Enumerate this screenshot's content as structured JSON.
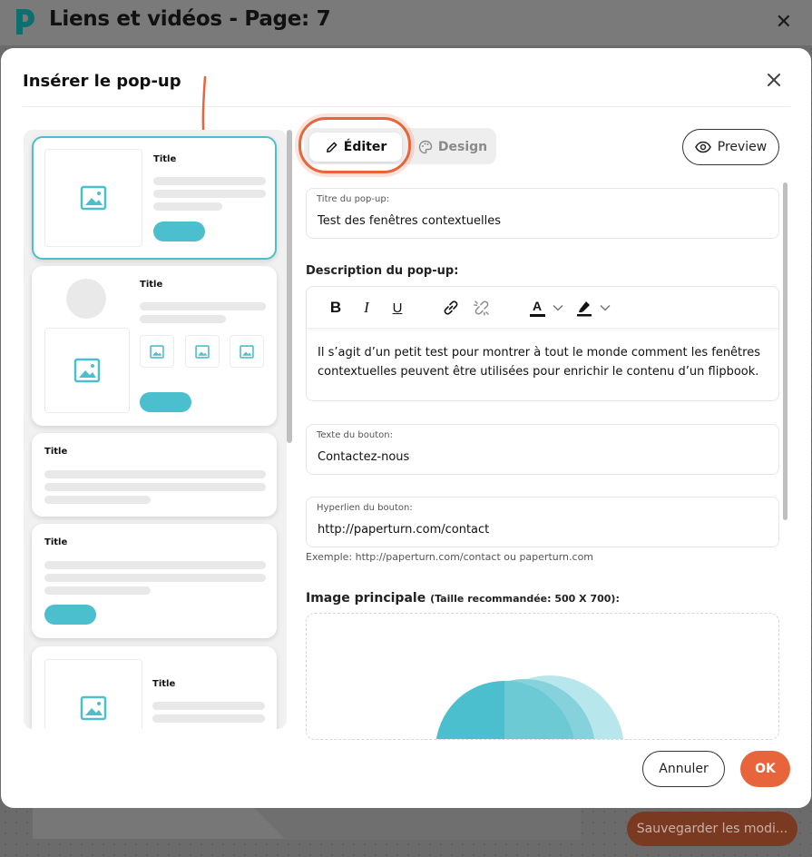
{
  "app": {
    "title": "Liens et vidéos - Page: 7",
    "save_label": "Sauvegarder les modi..."
  },
  "modal": {
    "title": "Insérer le pop-up",
    "tabs": {
      "edit": "Éditer",
      "design": "Design"
    },
    "preview_label": "Preview",
    "cancel_label": "Annuler",
    "ok_label": "OK"
  },
  "templates": {
    "title_text": "Title"
  },
  "form": {
    "popup_title": {
      "label": "Titre du pop-up:",
      "value": "Test des fenêtres contextuelles"
    },
    "description": {
      "label": "Description du pop-up:",
      "value": "Il s’agit d’un petit test pour montrer à tout le monde comment les fenêtres contextuelles peuvent être utilisées pour enrichir le contenu d’un flipbook."
    },
    "button_text": {
      "label": "Texte du bouton:",
      "value": "Contactez-nous"
    },
    "button_link": {
      "label": "Hyperlien du bouton:",
      "value": "http://paperturn.com/contact"
    },
    "link_hint": "Exemple: http://paperturn.com/contact ou paperturn.com",
    "main_image": {
      "label": "Image principale",
      "sub": "(Taille recommandée: 500 X 700):"
    }
  },
  "toolbar": {
    "bold": "B",
    "italic": "I",
    "underline": "U",
    "text_color": "A"
  },
  "colors": {
    "accent_teal": "#4bbfcd",
    "accent_orange": "#e8643a"
  },
  "icons": [
    "app-logo-icon",
    "close-icon",
    "pencil-icon",
    "palette-icon",
    "eye-icon",
    "image-icon",
    "link-icon",
    "unlink-icon",
    "highlighter-icon",
    "chevron-down-icon",
    "arrow-down-icon"
  ]
}
